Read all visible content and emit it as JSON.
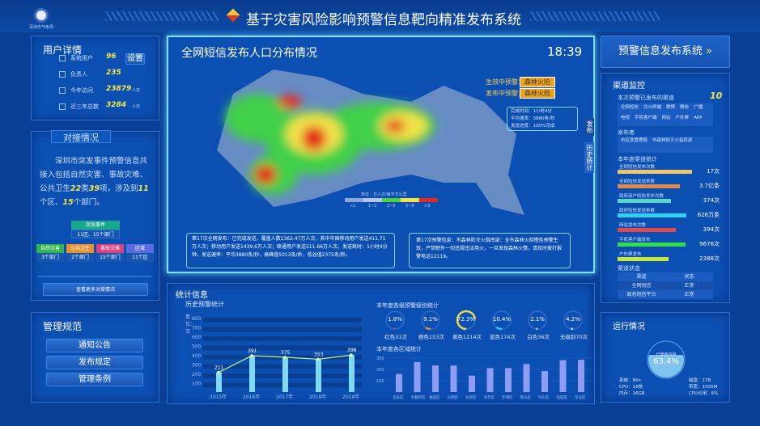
{
  "header": {
    "title": "基于灾害风险影响预警信息靶向精准发布系统",
    "logo_text": "深圳市气象局"
  },
  "user_panel": {
    "title": "用户详情",
    "settings_label": "设置",
    "rows": [
      {
        "label": "系统用户",
        "value": "96",
        "unit": ""
      },
      {
        "label": "负责人",
        "value": "235",
        "unit": ""
      },
      {
        "label": "今年访问",
        "value": "23879",
        "unit": "人次"
      },
      {
        "label": "近三年总数",
        "value": "3284",
        "unit": "人次"
      }
    ]
  },
  "docking": {
    "title": "对接情况",
    "text_parts": [
      "深圳市突发事件预警信息共接入包括自然灾害、事故灾难、公共卫生",
      "22",
      "类",
      "39",
      "项，涉及到",
      "11",
      "个区、",
      "15",
      "个部门。"
    ],
    "root": {
      "label": "突发事件",
      "sub": "11区、15个部门"
    },
    "children": [
      {
        "label": "自然灾害",
        "sub": "3个部门",
        "color": "#2fb84a"
      },
      {
        "label": "公共卫生",
        "sub": "2个部门",
        "color": "#e9912a"
      },
      {
        "label": "事故灾难",
        "sub": "15个部门",
        "color": "#e0407e"
      },
      {
        "label": "区域",
        "sub": "11个区",
        "color": "#5a6de0"
      }
    ],
    "more_label": "查看更多对接情况"
  },
  "mgmt": {
    "title": "管理规范",
    "buttons": [
      "通知公告",
      "发布规定",
      "管理条例"
    ]
  },
  "map": {
    "title": "全网短信发布人口分布情况",
    "time": "18:39",
    "effective_label": "生效中预警：",
    "effective_value": "森林火险",
    "publishing_label": "发布中预警：",
    "publishing_value": "森林火险",
    "info": [
      "完成时间：1小时4分",
      "平均速率：3880条/秒",
      "发送进度：100%完成"
    ],
    "side_tabs": [
      "发布",
      "历史统计"
    ],
    "legend_title": "单位：万人次/每平方公里",
    "legend_labels": [
      "<1",
      "1~2",
      "2~5",
      "5~9",
      ">9"
    ],
    "legend_colors": [
      "#8fa6d8",
      "#b7c5e8",
      "#4fd13c",
      "#f1e24a",
      "#e52a1e"
    ],
    "msg1": "第17次全网发布：已完成发送，覆盖人数2362.47万人次，其中中国移动用户发送411.71万人次；移动用户发送1439.6万人次；联通用户发送511.66万人次。发送耗时：1小时4分钟，发送速率：平均3880条/秒，高峰值5013条/秒，低谷值2375条/秒。",
    "msg2": "第17次预警信息：市森林防灭火指挥部：全市森林火险橙色预警生效，严禁野外一切违规违法用火，一旦发现森林火情，请及时拨打报警电话12119。"
  },
  "stats": {
    "title": "统计信息",
    "history": {
      "title": "历史预警统计",
      "unit": "单位：次",
      "yticks": [
        "800",
        "700",
        "600",
        "500",
        "400",
        "300",
        "200",
        "100"
      ]
    },
    "levels_title": "本年度各级预警级别统计",
    "levels": [
      {
        "pct": "1.8%",
        "label": "红色31次",
        "value": 1.8,
        "color": "#e0403a"
      },
      {
        "pct": "9.1%",
        "label": "橙色153次",
        "value": 9.1,
        "color": "#e98a3a"
      },
      {
        "pct": "72.3%",
        "label": "黄色1214次",
        "value": 72.3,
        "color": "#e8d84a"
      },
      {
        "pct": "10.4%",
        "label": "蓝色174次",
        "value": 10.4,
        "color": "#2fc4f0"
      },
      {
        "pct": "2.1%",
        "label": "白色36次",
        "value": 2.1,
        "color": "#ffffff"
      },
      {
        "pct": "4.2%",
        "label": "无级别70次",
        "value": 4.2,
        "color": "#7fe4ff"
      }
    ],
    "region_title": "本年度各区域统计"
  },
  "chart_data": [
    {
      "type": "bar",
      "title": "历史预警统计",
      "categories": [
        "2015年",
        "2016年",
        "2017年",
        "2018年",
        "2019年"
      ],
      "values": [
        211,
        391,
        375,
        353,
        398
      ],
      "ylabel": "单位：次",
      "ylim": [
        0,
        800
      ],
      "line_overlay": true
    },
    {
      "type": "bar",
      "title": "本年度各区域统计",
      "categories": [
        "宝安区",
        "大鹏新区",
        "福田区",
        "光明区",
        "龙岗区",
        "龙华区",
        "罗湖区",
        "南山区",
        "坪山区",
        "盐田区",
        "深汕区"
      ],
      "values": [
        160,
        265,
        235,
        235,
        145,
        212,
        212,
        248,
        185,
        282,
        285
      ],
      "ylim": [
        0,
        300
      ],
      "yticks": [
        "300",
        "200",
        "100"
      ]
    }
  ],
  "right": {
    "system_button": "预警信息发布系统",
    "system_arrow": "»",
    "channel": {
      "title": "渠道监控",
      "channels_label": "本次预警已发布的渠道",
      "channels_count": "10",
      "channels": [
        "全网短信",
        "北斗终端",
        "微博",
        "微信",
        "广播",
        "电视",
        "手机客户端",
        "网站",
        "户外屏",
        "APP"
      ],
      "publisher_label": "发布者",
      "publishers": [
        "市应急管理局",
        "市森林防灭火指挥部"
      ],
      "stats_label": "本年度渠道统计",
      "bars": [
        {
          "label": "全网短信发布次数",
          "value": "17次",
          "fill": 0.92,
          "color": "#f1c56a"
        },
        {
          "label": "全网短信发送条数",
          "value": "3.7亿条",
          "fill": 0.77,
          "color": "#e08a4a"
        },
        {
          "label": "政府用户短信发布次数",
          "value": "374次",
          "fill": 0.66,
          "color": "#5ad6c8"
        },
        {
          "label": "政府短信发送条数",
          "value": "626万条",
          "fill": 0.85,
          "color": "#2fd2f0"
        },
        {
          "label": "网站发布次数",
          "value": "394次",
          "fill": 0.72,
          "color": "#e04a4a"
        },
        {
          "label": "手机客户端发布",
          "value": "9676次",
          "fill": 0.84,
          "color": "#2fe04a"
        },
        {
          "label": "户外屏发布",
          "value": "2388次",
          "fill": 0.63,
          "color": "#c8e83a"
        }
      ],
      "status_label": "渠道状态",
      "status_header": [
        "渠道",
        "状态"
      ],
      "status_rows": [
        [
          "全网短信",
          "正常"
        ],
        [
          "政务短信平台",
          "正常"
        ]
      ]
    },
    "run": {
      "title": "运行情况",
      "gauge_label": "已使用内存",
      "gauge_value": "63.4%",
      "gauge_fraction": 0.634,
      "left": [
        "系统：Win",
        "CPU：16核",
        "内存：16GB"
      ],
      "right": [
        "磁盘：1TB",
        "带宽：1000M",
        "CPU占用：6%"
      ]
    }
  }
}
